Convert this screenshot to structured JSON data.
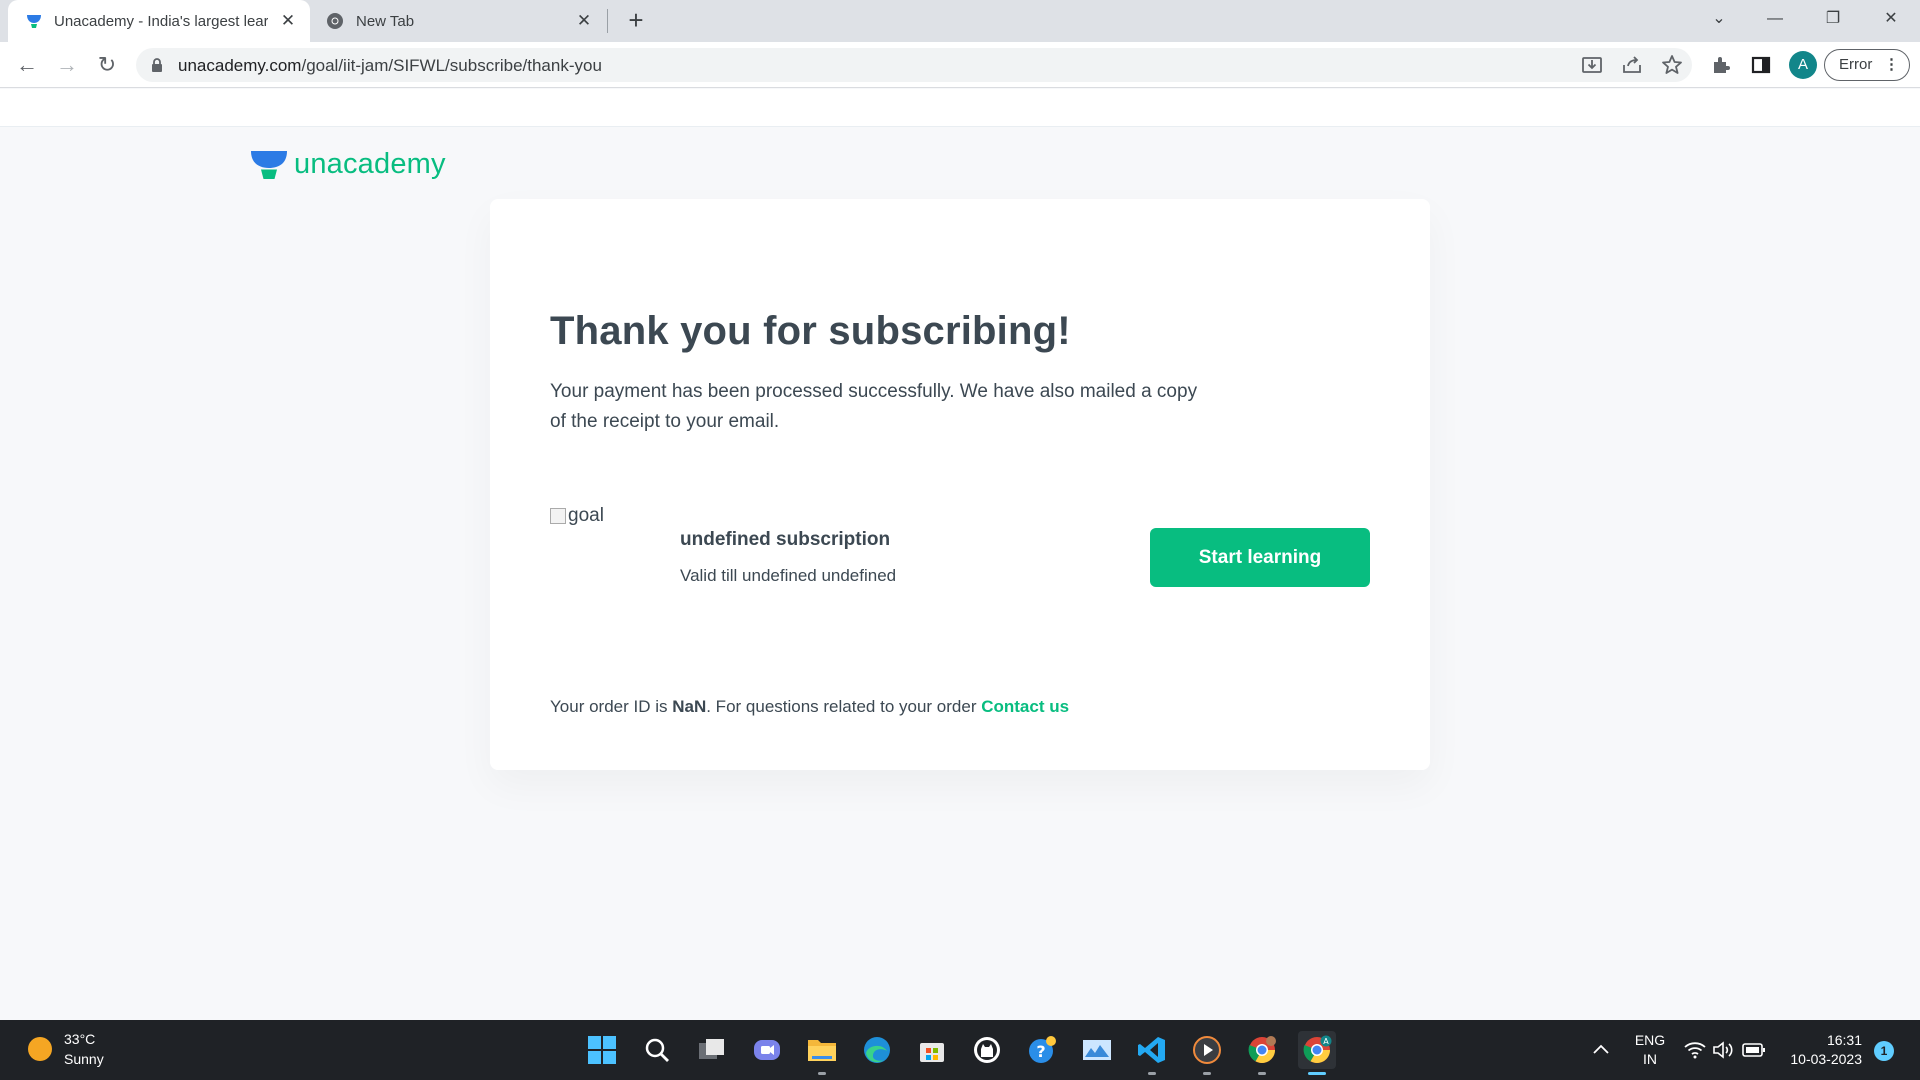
{
  "browser": {
    "tabs": [
      {
        "title": "Unacademy - India's largest learning platform",
        "active": true
      },
      {
        "title": "New Tab",
        "active": false
      }
    ],
    "url_host": "unacademy.com",
    "url_path": "/goal/iit-jam/SIFWL/subscribe/thank-you",
    "profile_initial": "A",
    "error_label": "Error"
  },
  "brand": {
    "logo_text": "unacademy",
    "color": "#08bd80"
  },
  "card": {
    "heading": "Thank you for subscribing!",
    "description": "Your payment has been processed successfully. We have also mailed a copy of the receipt to your email.",
    "goal_image_alt": "goal",
    "subscription_title": "undefined subscription",
    "subscription_validity": "Valid till undefined undefined",
    "cta_label": "Start learning",
    "order_prefix": "Your order ID is",
    "order_id": "NaN",
    "order_suffix": ". For questions related to your order",
    "contact_label": "Contact us"
  },
  "taskbar": {
    "weather_temp": "33°C",
    "weather_condition": "Sunny",
    "lang_line1": "ENG",
    "lang_line2": "IN",
    "time": "16:31",
    "date": "10-03-2023",
    "notification_count": "1",
    "apps": [
      "start-icon",
      "search-icon",
      "task-view-icon",
      "teams-chat-icon",
      "file-explorer-icon",
      "edge-icon",
      "store-icon",
      "github-icon",
      "help-icon",
      "photos-icon",
      "vscode-icon",
      "media-player-icon",
      "chrome-icon",
      "chrome-profile-icon"
    ]
  }
}
